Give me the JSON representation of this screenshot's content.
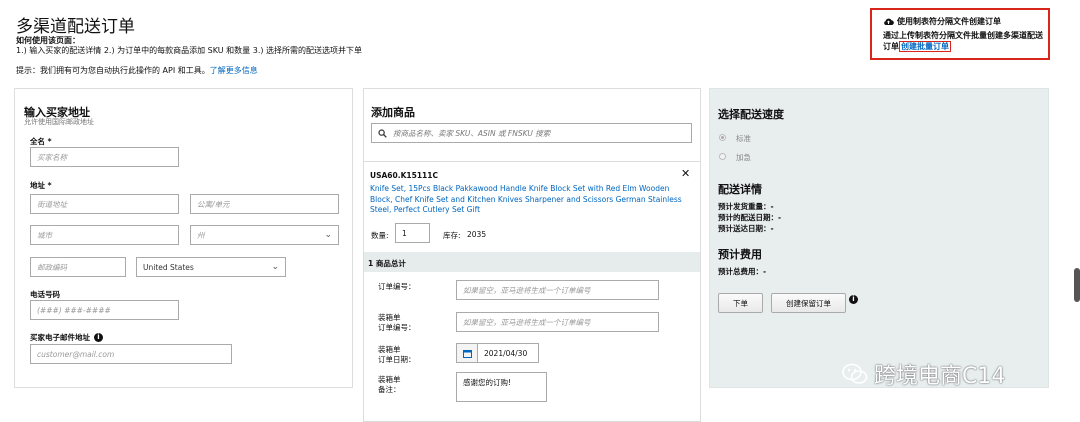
{
  "page": {
    "title": "多渠道配送订单",
    "howto_heading": "如何使用该页面：",
    "howto_text": "1.) 输入买家的配送详情 2.) 为订单中的每款商品添加 SKU 和数量 3.) 选择所需的配送选项并下单",
    "hint_text": "提示：我们拥有可为您自动执行此操作的 API 和工具。",
    "hint_link": "了解更多信息"
  },
  "bulk_box": {
    "title": "使用制表符分隔文件创建订单",
    "desc": "通过上传制表符分隔文件批量创建多渠道配送订单",
    "link": "创建批量订单",
    "icon": "cloud-upload-icon"
  },
  "buyer": {
    "heading": "输入买家地址",
    "subheading": "允许使用国际邮政地址",
    "fullname_label": "全名 *",
    "fullname_placeholder": "买家名称",
    "address_label": "地址 *",
    "street_placeholder": "街道地址",
    "apt_placeholder": "公寓/单元",
    "city_placeholder": "城市",
    "state_placeholder": "州",
    "zip_placeholder": "邮政编码",
    "country_value": "United States",
    "phone_label": "电话号码",
    "phone_placeholder": "(###) ###-####",
    "email_label": "买家电子邮件地址",
    "email_placeholder": "customer@mail.com"
  },
  "products": {
    "heading": "添加商品",
    "search_placeholder": "按商品名称、卖家 SKU、ASIN 或 FNSKU 搜索",
    "item_sku": "USA60.K15111C",
    "item_title": "Knife Set, 15Pcs Black Pakkawood Handle Knife Block Set with Red Elm Wooden Block, Chef Knife Set and Kitchen Knives Sharpener and Scissors German Stainless Steel, Perfect Cutlery Set Gift",
    "qty_label": "数量:",
    "qty_value": "1",
    "stock_label": "库存:",
    "stock_value": "2035",
    "total_label": "1 商品总计",
    "order_id_label": "订单编号：",
    "order_id_placeholder": "如果留空，亚马逊将生成一个订单编号",
    "packslip_id_label_1": "装箱单",
    "packslip_id_label_2": "订单编号：",
    "packslip_id_placeholder": "如果留空，亚马逊将生成一个订单编号",
    "packslip_date_label_1": "装箱单",
    "packslip_date_label_2": "订单日期：",
    "packslip_date_value": "2021/04/30",
    "packslip_note_label_1": "装箱单",
    "packslip_note_label_2": "备注：",
    "packslip_note_value": "感谢您的订购!"
  },
  "shipping": {
    "heading": "选择配送速度",
    "option_standard": "标准",
    "option_expedited": "加急",
    "details_heading": "配送详情",
    "weight_label": "预计发货重量：-",
    "ship_date_label": "预计的配送日期：-",
    "arrival_label": "预计送达日期：-",
    "fees_heading": "预计费用",
    "total_fee_label": "预计总费用：-",
    "place_order": "下单",
    "create_hold": "创建保留订单"
  },
  "watermark": {
    "text": "跨境电商C14"
  },
  "colors": {
    "link": "#0066c0",
    "highlight_red": "#d9261c",
    "shipping_panel_bg": "#e8eeee"
  }
}
